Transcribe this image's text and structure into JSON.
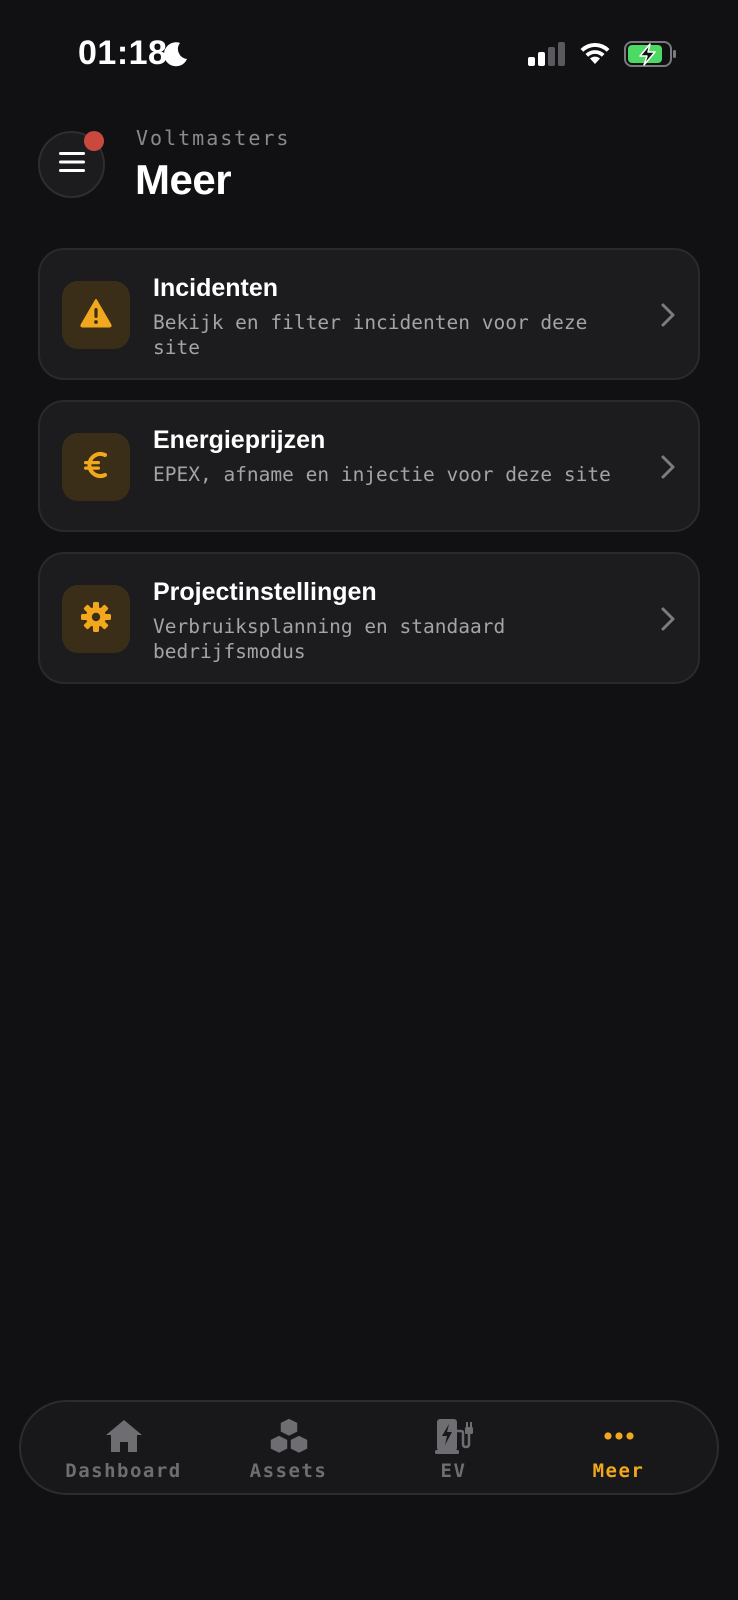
{
  "status_bar": {
    "time": "01:18",
    "icons": [
      "moon-icon",
      "cellular-signal-icon",
      "wifi-icon",
      "battery-charging-icon"
    ]
  },
  "header": {
    "subtitle": "Voltmasters",
    "title": "Meer",
    "menu_icon": "hamburger-menu-icon",
    "notification_dot_color": "#c9493f"
  },
  "menu_cards": [
    {
      "title": "Incidenten",
      "description": "Bekijk en filter incidenten voor deze site",
      "icon": "warning-icon"
    },
    {
      "title": "Energieprijzen",
      "description": "EPEX, afname en injectie voor deze site",
      "icon": "euro-icon"
    },
    {
      "title": "Projectinstellingen",
      "description": "Verbruiksplanning en standaard bedrijfsmodus",
      "icon": "gear-icon"
    }
  ],
  "tab_bar": {
    "tabs": [
      {
        "label": "Dashboard",
        "icon": "home-icon",
        "active": false
      },
      {
        "label": "Assets",
        "icon": "cubes-icon",
        "active": false
      },
      {
        "label": "EV",
        "icon": "ev-charger-icon",
        "active": false
      },
      {
        "label": "Meer",
        "icon": "more-dots-icon",
        "active": true
      }
    ]
  },
  "colors": {
    "background": "#111113",
    "card_background": "#1c1c1e",
    "accent": "#f2a81c",
    "icon_tile_background": "#3a2e18",
    "battery_green": "#4cd964"
  }
}
